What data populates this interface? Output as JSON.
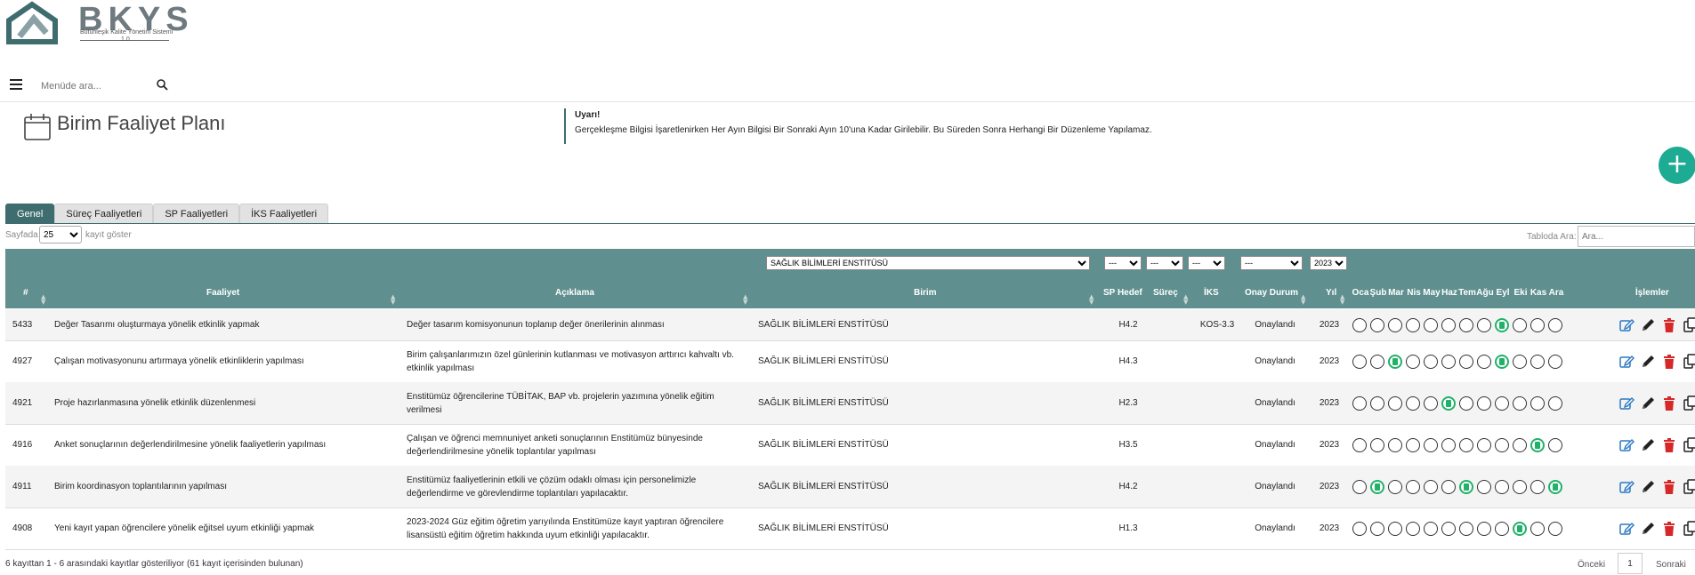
{
  "logo": {
    "text": "BKYS",
    "subtitle": "Bütünleşik Kalite Yönetim Sistemi",
    "version": "1.0"
  },
  "menu": {
    "search_placeholder": "Menüde ara...",
    "search_icon": "search-icon",
    "menu_icon": "hamburger-icon"
  },
  "page": {
    "title": "Birim Faaliyet Planı",
    "warning_title": "Uyarı!",
    "warning_text": "Gerçekleşme Bilgisi İşaretlenirken Her Ayın Bilgisi Bir Sonraki Ayın 10'una Kadar Girilebilir. Bu Süreden Sonra Herhangi Bir Düzenleme Yapılamaz.",
    "add_icon": "+"
  },
  "tabs": [
    {
      "label": "Genel",
      "active": true
    },
    {
      "label": "Süreç Faaliyetleri",
      "active": false
    },
    {
      "label": "SP Faaliyetleri",
      "active": false
    },
    {
      "label": "İKS Faaliyetleri",
      "active": false
    }
  ],
  "table_controls": {
    "length_prefix": "Sayfada",
    "length_value": "25",
    "length_suffix": "kayıt göster",
    "search_label": "Tabloda Ara:",
    "search_placeholder": "Ara..."
  },
  "filters": {
    "birim": "SAĞLIK BİLİMLERİ ENSTİTÜSÜ",
    "sp_hedef": "---",
    "surec": "---",
    "iks": "---",
    "onay": "---",
    "yil": "2023"
  },
  "columns": {
    "no": "#",
    "faaliyet": "Faaliyet",
    "aciklama": "Açıklama",
    "birim": "Birim",
    "sp_hedef": "SP Hedef",
    "surec": "Süreç",
    "iks": "İKS",
    "onay": "Onay Durum",
    "yil": "Yıl",
    "months": [
      "Oca",
      "Şub",
      "Mar",
      "Nis",
      "May",
      "Haz",
      "Tem",
      "Ağu",
      "Eyl",
      "Eki",
      "Kas",
      "Ara"
    ],
    "islemler": "İşlemler"
  },
  "rows": [
    {
      "id": "5433",
      "faaliyet": "Değer Tasarımı oluşturmaya yönelik etkinlik yapmak",
      "aciklama": [
        "Değer tasarım komisyonunun toplanıp değer önerilerinin alınması"
      ],
      "birim": "SAĞLIK BİLİMLERİ ENSTİTÜSÜ",
      "sp_hedef": "H4.2",
      "surec": "",
      "iks": "KOS-3.3",
      "onay": "Onaylandı",
      "yil": "2023",
      "months": [
        0,
        0,
        0,
        0,
        0,
        0,
        0,
        0,
        1,
        0,
        0,
        0
      ]
    },
    {
      "id": "4927",
      "faaliyet": "Çalışan motivasyonunu artırmaya yönelik etkinliklerin yapılması",
      "aciklama": [
        "Birim çalışanlarımızın özel günlerinin kutlanması ve motivasyon arttırıcı kahvaltı vb.",
        "etkinlik yapılması"
      ],
      "birim": "SAĞLIK BİLİMLERİ ENSTİTÜSÜ",
      "sp_hedef": "H4.3",
      "surec": "",
      "iks": "",
      "onay": "Onaylandı",
      "yil": "2023",
      "months": [
        0,
        0,
        1,
        0,
        0,
        0,
        0,
        0,
        1,
        0,
        0,
        0
      ]
    },
    {
      "id": "4921",
      "faaliyet": "Proje hazırlanmasına yönelik etkinlik düzenlenmesi",
      "aciklama": [
        "Enstitümüz öğrencilerine TÜBİTAK, BAP vb. projelerin yazımına yönelik eğitim",
        "verilmesi"
      ],
      "birim": "SAĞLIK BİLİMLERİ ENSTİTÜSÜ",
      "sp_hedef": "H2.3",
      "surec": "",
      "iks": "",
      "onay": "Onaylandı",
      "yil": "2023",
      "months": [
        0,
        0,
        0,
        0,
        0,
        1,
        0,
        0,
        0,
        0,
        0,
        0
      ]
    },
    {
      "id": "4916",
      "faaliyet": "Anket sonuçlarının değerlendirilmesine yönelik faaliyetlerin yapılması",
      "aciklama": [
        "Çalışan ve öğrenci memnuniyet anketi sonuçlarının Enstitümüz bünyesinde",
        "değerlendirilmesine yönelik toplantılar yapılması"
      ],
      "birim": "SAĞLIK BİLİMLERİ ENSTİTÜSÜ",
      "sp_hedef": "H3.5",
      "surec": "",
      "iks": "",
      "onay": "Onaylandı",
      "yil": "2023",
      "months": [
        0,
        0,
        0,
        0,
        0,
        0,
        0,
        0,
        0,
        0,
        1,
        0
      ]
    },
    {
      "id": "4911",
      "faaliyet": "Birim koordinasyon toplantılarının yapılması",
      "aciklama": [
        "Enstitümüz faaliyetlerinin etkili ve çözüm odaklı olması için personelimizle",
        "değerlendirme ve görevlendirme toplantıları yapılacaktır."
      ],
      "birim": "SAĞLIK BİLİMLERİ ENSTİTÜSÜ",
      "sp_hedef": "H4.2",
      "surec": "",
      "iks": "",
      "onay": "Onaylandı",
      "yil": "2023",
      "months": [
        0,
        1,
        0,
        0,
        0,
        0,
        1,
        0,
        0,
        0,
        0,
        1
      ]
    },
    {
      "id": "4908",
      "faaliyet": "Yeni kayıt yapan öğrencilere yönelik eğitsel uyum etkinliği yapmak",
      "aciklama": [
        "2023-2024 Güz eğitim öğretim yarıyılında Enstitümüze kayıt yaptıran öğrencilere",
        "lisansüstü eğitim öğretim hakkında uyum etkinliği yapılacaktır."
      ],
      "birim": "SAĞLIK BİLİMLERİ ENSTİTÜSÜ",
      "sp_hedef": "H1.3",
      "surec": "",
      "iks": "",
      "onay": "Onaylandı",
      "yil": "2023",
      "months": [
        0,
        0,
        0,
        0,
        0,
        0,
        0,
        0,
        0,
        1,
        0,
        0
      ]
    }
  ],
  "footer": {
    "info": "6 kayıttan 1 - 6 arasındaki kayıtlar gösteriliyor (61 kayıt içerisinden bulunan)",
    "prev": "Önceki",
    "current_page": "1",
    "next": "Sonraki"
  },
  "colors": {
    "header_bg": "#5f8f8e",
    "tab_active": "#3f6d6f",
    "fab": "#1dab93",
    "month_done": "#22b16a",
    "edit": "#2b78c2",
    "delete": "#d62828"
  }
}
